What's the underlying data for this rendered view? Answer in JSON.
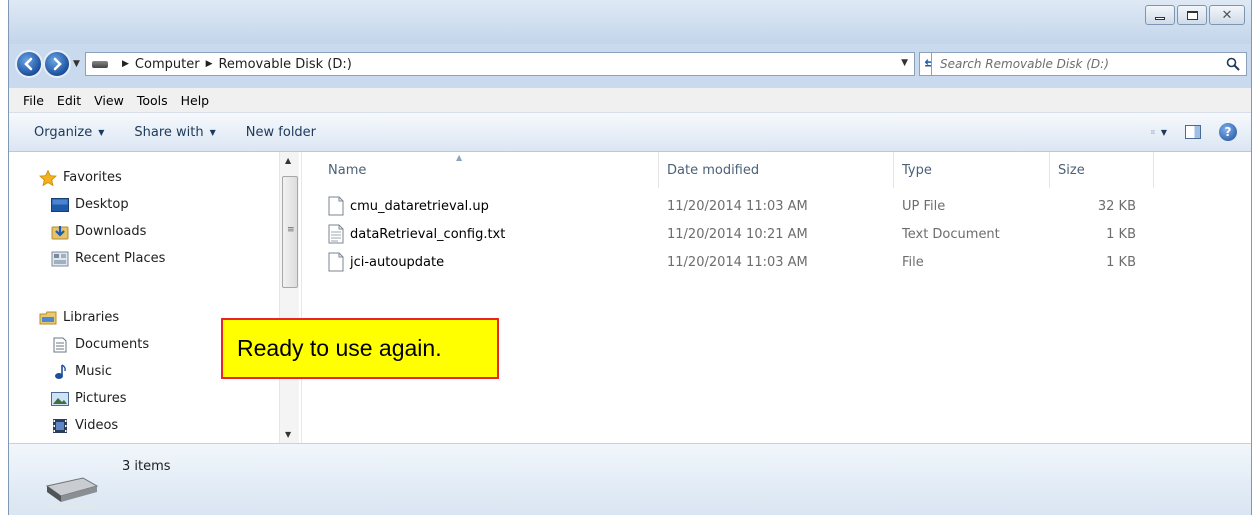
{
  "window": {
    "controls": [
      "minimize-icon",
      "maximize-icon",
      "close-icon"
    ]
  },
  "address": {
    "crumbs": [
      "Computer",
      "Removable Disk (D:)"
    ]
  },
  "search": {
    "placeholder": "Search Removable Disk (D:)"
  },
  "menu": [
    "File",
    "Edit",
    "View",
    "Tools",
    "Help"
  ],
  "toolbar": {
    "organize": "Organize",
    "share": "Share with",
    "new_folder": "New folder"
  },
  "nav": {
    "favorites": {
      "label": "Favorites",
      "items": [
        "Desktop",
        "Downloads",
        "Recent Places"
      ]
    },
    "libraries": {
      "label": "Libraries",
      "items": [
        "Documents",
        "Music",
        "Pictures",
        "Videos"
      ]
    }
  },
  "columns": {
    "name": "Name",
    "date": "Date modified",
    "type": "Type",
    "size": "Size"
  },
  "files": [
    {
      "name": "cmu_dataretrieval.up",
      "date": "11/20/2014 11:03 AM",
      "type": "UP File",
      "size": "32 KB"
    },
    {
      "name": "dataRetrieval_config.txt",
      "date": "11/20/2014 10:21 AM",
      "type": "Text Document",
      "size": "1 KB"
    },
    {
      "name": "jci-autoupdate",
      "date": "11/20/2014 11:03 AM",
      "type": "File",
      "size": "1 KB"
    }
  ],
  "callout": {
    "text": "Ready to use again."
  },
  "status": {
    "count": "3 items"
  },
  "colors": {
    "callout_bg": "#ffff00",
    "callout_border": "#e8262a",
    "link_text": "#1e395b"
  }
}
